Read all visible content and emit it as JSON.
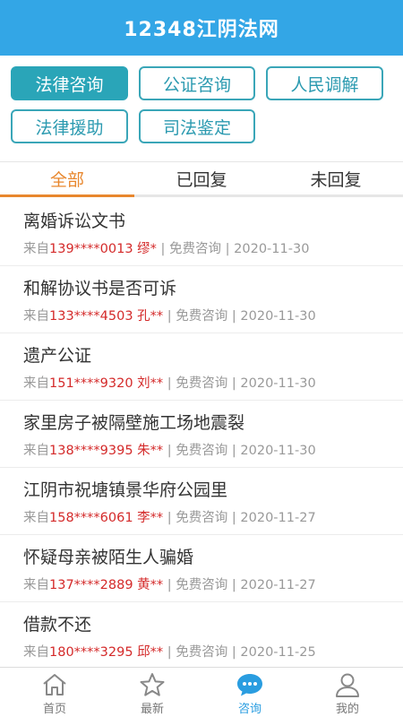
{
  "header": {
    "title": "12348江阴法网"
  },
  "categories": [
    {
      "label": "法律咨询",
      "active": true
    },
    {
      "label": "公证咨询",
      "active": false
    },
    {
      "label": "人民调解",
      "active": false
    },
    {
      "label": "法律援助",
      "active": false
    },
    {
      "label": "司法鉴定",
      "active": false
    }
  ],
  "tabs": [
    {
      "label": "全部",
      "active": true
    },
    {
      "label": "已回复",
      "active": false
    },
    {
      "label": "未回复",
      "active": false
    }
  ],
  "items": [
    {
      "title": "离婚诉讼文书",
      "from": "来自",
      "user": "139****0013 缪*",
      "sep1": " | ",
      "type": "免费咨询",
      "sep2": " | ",
      "date": "2020-11-30"
    },
    {
      "title": "和解协议书是否可诉",
      "from": "来自",
      "user": "133****4503 孔**",
      "sep1": " | ",
      "type": "免费咨询",
      "sep2": " | ",
      "date": "2020-11-30"
    },
    {
      "title": "遗产公证",
      "from": "来自",
      "user": "151****9320 刘**",
      "sep1": " | ",
      "type": "免费咨询",
      "sep2": " | ",
      "date": "2020-11-30"
    },
    {
      "title": "家里房子被隔壁施工场地震裂",
      "from": "来自",
      "user": "138****9395 朱**",
      "sep1": " | ",
      "type": "免费咨询",
      "sep2": " | ",
      "date": "2020-11-30"
    },
    {
      "title": "江阴市祝塘镇景华府公园里",
      "from": "来自",
      "user": "158****6061 李**",
      "sep1": " | ",
      "type": "免费咨询",
      "sep2": " | ",
      "date": "2020-11-27"
    },
    {
      "title": "怀疑母亲被陌生人骗婚",
      "from": "来自",
      "user": "137****2889 黄**",
      "sep1": " | ",
      "type": "免费咨询",
      "sep2": " | ",
      "date": "2020-11-27"
    },
    {
      "title": "借款不还",
      "from": "来自",
      "user": "180****3295 邱**",
      "sep1": " | ",
      "type": "免费咨询",
      "sep2": " | ",
      "date": "2020-11-25"
    }
  ],
  "nav": [
    {
      "label": "首页",
      "icon": "home-icon",
      "active": false
    },
    {
      "label": "最新",
      "icon": "star-icon",
      "active": false
    },
    {
      "label": "咨询",
      "icon": "chat-icon",
      "active": true
    },
    {
      "label": "我的",
      "icon": "user-icon",
      "active": false
    }
  ],
  "colors": {
    "header": "#33a6e6",
    "category_border": "#3aa6b8",
    "tab_active": "#e8872e",
    "user_highlight": "#d42a2a",
    "nav_active": "#2a9de0"
  }
}
